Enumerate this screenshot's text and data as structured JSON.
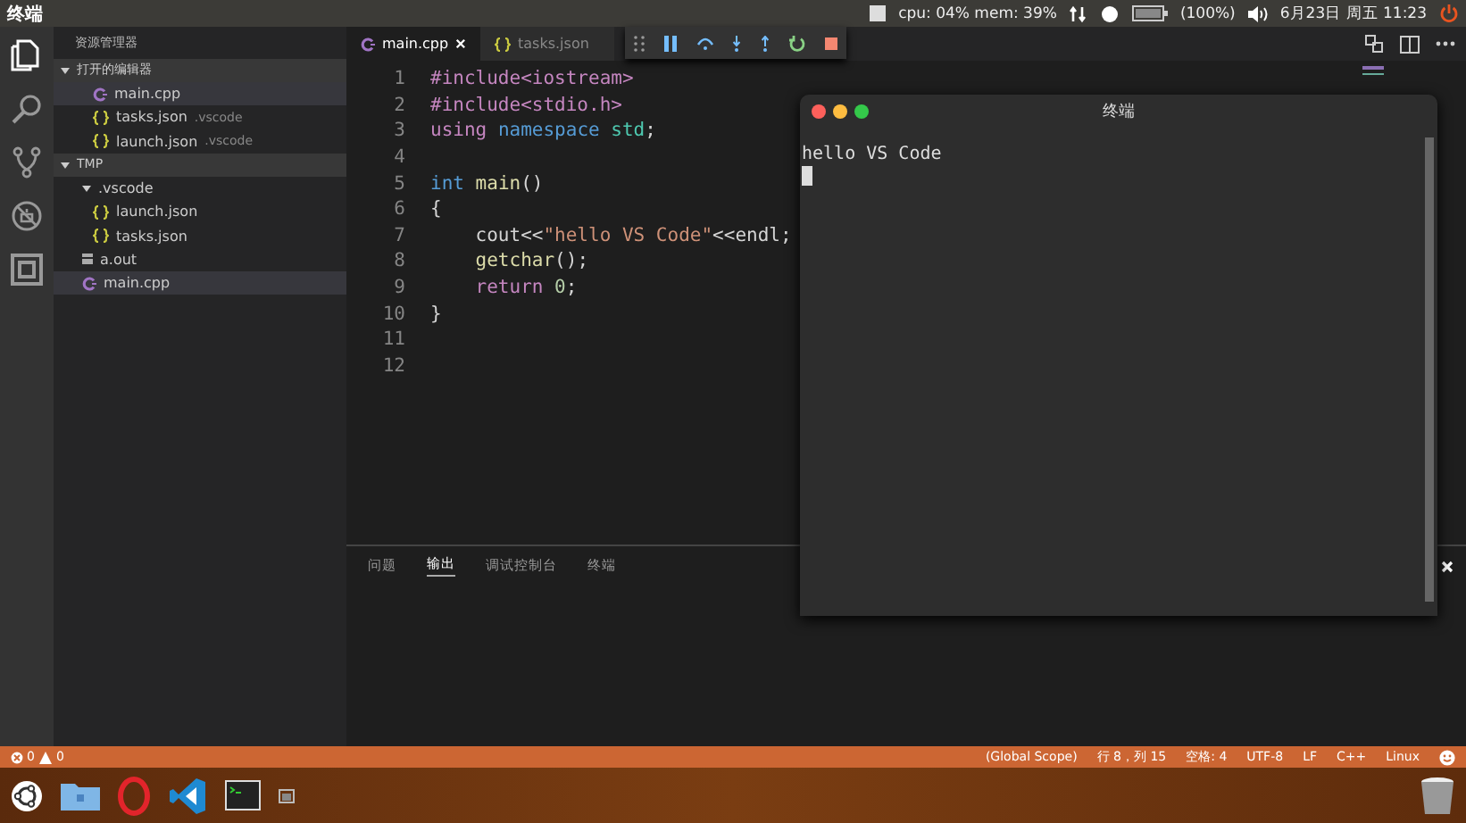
{
  "top_bar": {
    "title": "终端",
    "cpu_mem": "cpu: 04% mem: 39%",
    "battery": "(100%)",
    "clock": "6月23日 周五 11:23"
  },
  "activity_bar": [
    {
      "kind": "files",
      "selected": true
    },
    {
      "kind": "search",
      "selected": false
    },
    {
      "kind": "git",
      "selected": false
    },
    {
      "kind": "debug",
      "selected": false
    },
    {
      "kind": "extensions",
      "selected": false
    }
  ],
  "sidebar": {
    "title": "资源管理器",
    "sections": [
      {
        "label": "打开的编辑器",
        "expanded": true,
        "items": [
          {
            "kind": "cpp",
            "name": "main.cpp",
            "selected": true
          },
          {
            "kind": "json",
            "name": "tasks.json",
            "folder": ".vscode",
            "selected": false
          },
          {
            "kind": "json",
            "name": "launch.json",
            "folder": ".vscode",
            "selected": false
          }
        ]
      },
      {
        "label": "TMP",
        "expanded": true,
        "tree": [
          {
            "kind": "folder",
            "name": ".vscode",
            "expanded": true,
            "selected": false,
            "children": [
              {
                "kind": "json",
                "name": "launch.json",
                "selected": false
              },
              {
                "kind": "json",
                "name": "tasks.json",
                "selected": false
              }
            ]
          },
          {
            "kind": "file",
            "name": "a.out",
            "selected": false
          },
          {
            "kind": "cpp",
            "name": "main.cpp",
            "selected": true
          }
        ]
      }
    ]
  },
  "editor": {
    "tabs": [
      {
        "kind": "cpp",
        "label": "main.cpp",
        "selected": true
      },
      {
        "kind": "json",
        "label": "tasks.json",
        "selected": false
      }
    ],
    "lines": [
      {
        "number": "1",
        "tokens": [
          {
            "kind": "pp",
            "text": "#include<iostream>"
          }
        ]
      },
      {
        "number": "2",
        "tokens": [
          {
            "kind": "pp",
            "text": "#include<stdio.h>"
          }
        ]
      },
      {
        "number": "3",
        "tokens": [
          {
            "kind": "ctrl",
            "text": "using "
          },
          {
            "kind": "kw",
            "text": "namespace "
          },
          {
            "kind": "type",
            "text": "std"
          },
          {
            "kind": "plain",
            "text": ";"
          }
        ]
      },
      {
        "number": "4"
      },
      {
        "number": "5",
        "tokens": [
          {
            "kind": "kw",
            "text": "int "
          },
          {
            "kind": "fn",
            "text": "main"
          },
          {
            "kind": "plain",
            "text": "()"
          }
        ]
      },
      {
        "number": "6",
        "tokens": [
          {
            "kind": "plain",
            "text": "{"
          }
        ]
      },
      {
        "number": "7",
        "indented": true,
        "tokens": [
          {
            "kind": "plain",
            "text": "cout<<"
          },
          {
            "kind": "str",
            "text": "\"hello VS Code\""
          },
          {
            "kind": "plain",
            "text": "<<endl;"
          }
        ]
      },
      {
        "number": "8",
        "indented": true,
        "tokens": [
          {
            "kind": "fn",
            "text": "getchar"
          },
          {
            "kind": "plain",
            "text": "();"
          }
        ]
      },
      {
        "number": "9",
        "indented": true,
        "tokens": [
          {
            "kind": "ctrl",
            "text": "return "
          },
          {
            "kind": "num",
            "text": "0"
          },
          {
            "kind": "plain",
            "text": ";"
          }
        ]
      },
      {
        "number": "10",
        "tokens": [
          {
            "kind": "plain",
            "text": "}"
          }
        ]
      },
      {
        "number": "11"
      },
      {
        "number": "12"
      }
    ]
  },
  "panel": {
    "tabs": [
      {
        "label": "问题",
        "selected": false
      },
      {
        "label": "输出",
        "selected": true
      },
      {
        "label": "调试控制台",
        "selected": false
      },
      {
        "label": "终端",
        "selected": false
      }
    ]
  },
  "terminal_window": {
    "title": "终端",
    "output": "hello VS Code"
  },
  "status_bar": {
    "errors": "0",
    "warnings": "0",
    "items": [
      "(Global Scope)",
      "行 8，列 15",
      "空格: 4",
      "UTF-8",
      "LF",
      "C++",
      "Linux"
    ]
  },
  "dock": [
    {
      "kind": "ubuntu"
    },
    {
      "kind": "folder"
    },
    {
      "kind": "opera"
    },
    {
      "kind": "vscode"
    },
    {
      "kind": "terminal"
    },
    {
      "kind": "window"
    }
  ]
}
